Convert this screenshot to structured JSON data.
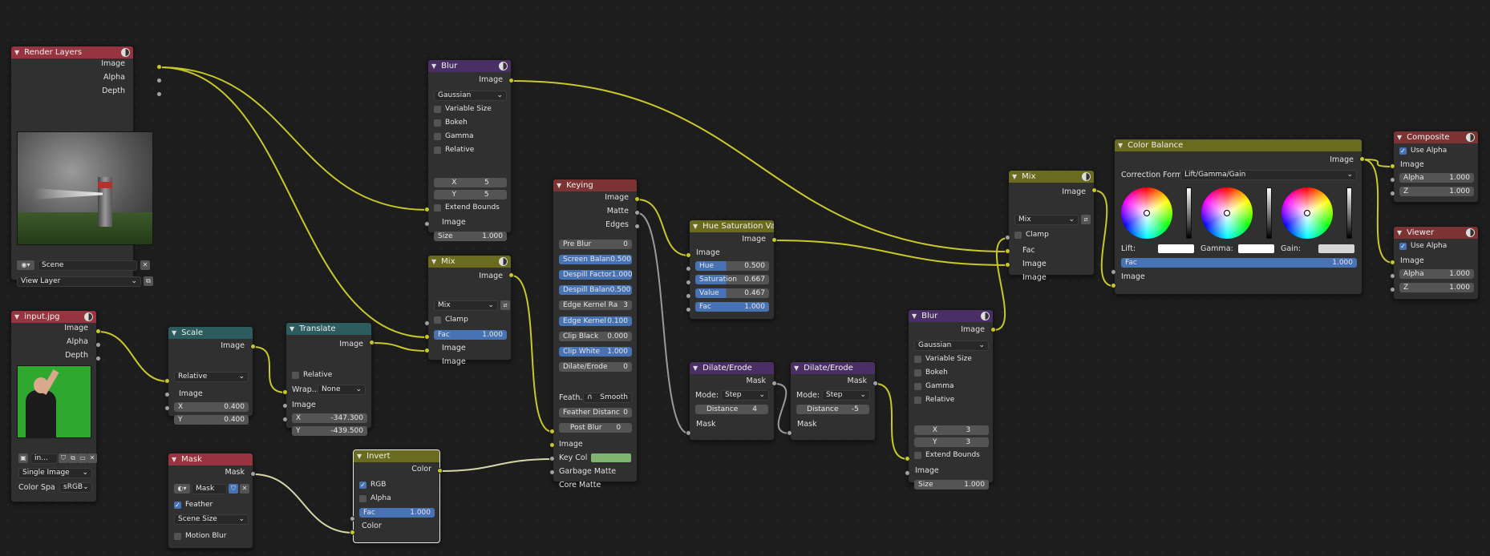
{
  "render_layers": {
    "title": "Render Layers",
    "outputs": [
      "Image",
      "Alpha",
      "Depth"
    ],
    "scene": "Scene",
    "view_layer": "View Layer"
  },
  "input_jpg": {
    "title": "input.jpg",
    "outputs": [
      "Image",
      "Alpha",
      "Depth"
    ],
    "file": "in...",
    "source": "Single Image",
    "color_space_label": "Color Spa",
    "color_space": "sRGB"
  },
  "scale": {
    "title": "Scale",
    "output": "Image",
    "space": "Relative",
    "input": "Image",
    "x_label": "X",
    "x": "0.400",
    "y_label": "Y",
    "y": "0.400"
  },
  "translate": {
    "title": "Translate",
    "output": "Image",
    "relative": "Relative",
    "wrap_label": "Wrap...",
    "wrap": "None",
    "input": "Image",
    "x_label": "X",
    "x": "-347.300",
    "y_label": "Y",
    "y": "-439.500"
  },
  "mask": {
    "title": "Mask",
    "output": "Mask",
    "name": "Mask",
    "feather": "Feather",
    "size": "Scene Size",
    "motion": "Motion Blur"
  },
  "invert": {
    "title": "Invert",
    "output": "Color",
    "rgb": "RGB",
    "alpha": "Alpha",
    "fac_label": "Fac",
    "fac": "1.000",
    "input": "Color"
  },
  "blur1": {
    "title": "Blur",
    "output": "Image",
    "filter": "Gaussian",
    "variable": "Variable Size",
    "bokeh": "Bokeh",
    "gamma": "Gamma",
    "relative": "Relative",
    "x_label": "X",
    "x": "5",
    "y_label": "Y",
    "y": "5",
    "extend": "Extend Bounds",
    "input": "Image",
    "size_label": "Size",
    "size": "1.000"
  },
  "mix1": {
    "title": "Mix",
    "output": "Image",
    "mode": "Mix",
    "clamp": "Clamp",
    "fac_label": "Fac",
    "fac": "1.000",
    "in1": "Image",
    "in2": "Image"
  },
  "keying": {
    "title": "Keying",
    "outputs": [
      "Image",
      "Matte",
      "Edges"
    ],
    "fields": [
      {
        "label": "Pre Blur",
        "value": "0",
        "blue": false
      },
      {
        "label": "Screen Balan",
        "value": "0.500",
        "blue": true
      },
      {
        "label": "Despill Factor",
        "value": "1.000",
        "blue": true
      },
      {
        "label": "Despill Balan",
        "value": "0.500",
        "blue": true
      },
      {
        "label": "Edge Kernel Ra",
        "value": "3",
        "blue": false
      },
      {
        "label": "Edge Kernel",
        "value": "0.100",
        "blue": true
      },
      {
        "label": "Clip Black",
        "value": "0.000",
        "blue": false
      },
      {
        "label": "Clip White",
        "value": "1.000",
        "blue": true
      },
      {
        "label": "Dilate/Erode",
        "value": "0",
        "blue": false
      }
    ],
    "feather_label": "Feath...",
    "feather": "Smooth",
    "feather_dist_label": "Feather Distanc",
    "feather_dist": "0",
    "post_blur_label": "Post Blur",
    "post_blur": "0",
    "inputs": [
      "Image",
      "Key Col",
      "Garbage Matte",
      "Core Matte"
    ],
    "key_color": "#7fb56f"
  },
  "hsv": {
    "title": "Hue Saturation Value",
    "output": "Image",
    "input": "Image",
    "fields": [
      {
        "label": "Hue",
        "value": "0.500"
      },
      {
        "label": "Saturation",
        "value": "0.667"
      },
      {
        "label": "Value",
        "value": "0.467"
      },
      {
        "label": "Fac",
        "value": "1.000"
      }
    ]
  },
  "dilate1": {
    "title": "Dilate/Erode",
    "output": "Mask",
    "mode_label": "Mode:",
    "mode": "Step",
    "dist_label": "Distance",
    "dist": "4",
    "input": "Mask"
  },
  "dilate2": {
    "title": "Dilate/Erode",
    "output": "Mask",
    "mode_label": "Mode:",
    "mode": "Step",
    "dist_label": "Distance",
    "dist": "-5",
    "input": "Mask"
  },
  "blur2": {
    "title": "Blur",
    "output": "Image",
    "filter": "Gaussian",
    "variable": "Variable Size",
    "bokeh": "Bokeh",
    "gamma": "Gamma",
    "relative": "Relative",
    "x_label": "X",
    "x": "3",
    "y_label": "Y",
    "y": "3",
    "extend": "Extend Bounds",
    "input": "Image",
    "size_label": "Size",
    "size": "1.000"
  },
  "mix2": {
    "title": "Mix",
    "output": "Image",
    "mode": "Mix",
    "clamp": "Clamp",
    "inputs": [
      "Fac",
      "Image",
      "Image"
    ]
  },
  "cbal": {
    "title": "Color Balance",
    "output": "Image",
    "formula_label": "Correction Formu",
    "formula": "Lift/Gamma/Gain",
    "lift": "Lift:",
    "gamma": "Gamma:",
    "gain": "Gain:",
    "fac_label": "Fac",
    "fac": "1.000",
    "input": "Image"
  },
  "composite": {
    "title": "Composite",
    "use_alpha": "Use Alpha",
    "inputs": [
      "Image",
      "Alpha",
      "Z"
    ],
    "alpha": "1.000",
    "z": "1.000"
  },
  "viewer": {
    "title": "Viewer",
    "use_alpha": "Use Alpha",
    "inputs": [
      "Image",
      "Alpha",
      "Z"
    ],
    "alpha": "1.000",
    "z": "1.000"
  },
  "colors": {
    "image_socket": "#c7c729",
    "value_socket": "#a1a1a1",
    "wire": "#c8c82c",
    "field_blue": "#4772b3"
  }
}
